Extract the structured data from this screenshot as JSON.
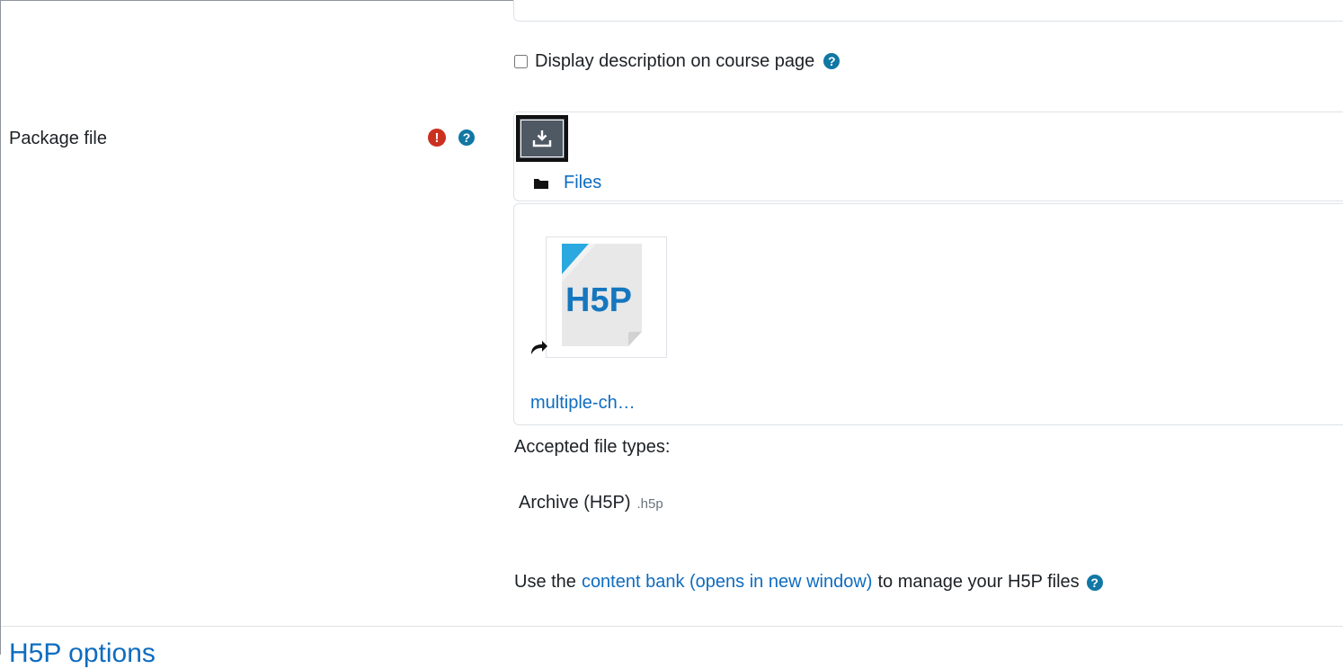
{
  "fields": {
    "display_description": {
      "label": "Display description on course page",
      "checked": false,
      "help_icon": "question-circle-icon"
    }
  },
  "package_file": {
    "label": "Package file",
    "required_icon": "exclamation-circle-icon",
    "help_icon": "question-circle-icon",
    "add_button_icon": "download-tray-icon",
    "files_icon": "folder-icon",
    "files_label": "Files",
    "file": {
      "thumbnail_icon": "h5p-file-icon",
      "thumbnail_text": "H5P",
      "link_icon": "share-arrow-icon",
      "name": "multiple-ch…"
    }
  },
  "accepted_types": {
    "title": "Accepted file types:",
    "type_name": "Archive (H5P)",
    "extension": ".h5p"
  },
  "content_bank": {
    "before": "Use the",
    "link": "content bank (opens in new window)",
    "after": "to manage your H5P files",
    "help_icon": "question-circle-icon"
  },
  "section": {
    "heading": "H5P options"
  },
  "colors": {
    "link": "#0f6cbf",
    "required": "#ca3120",
    "help": "#1177a4",
    "button": "#4f5964"
  }
}
